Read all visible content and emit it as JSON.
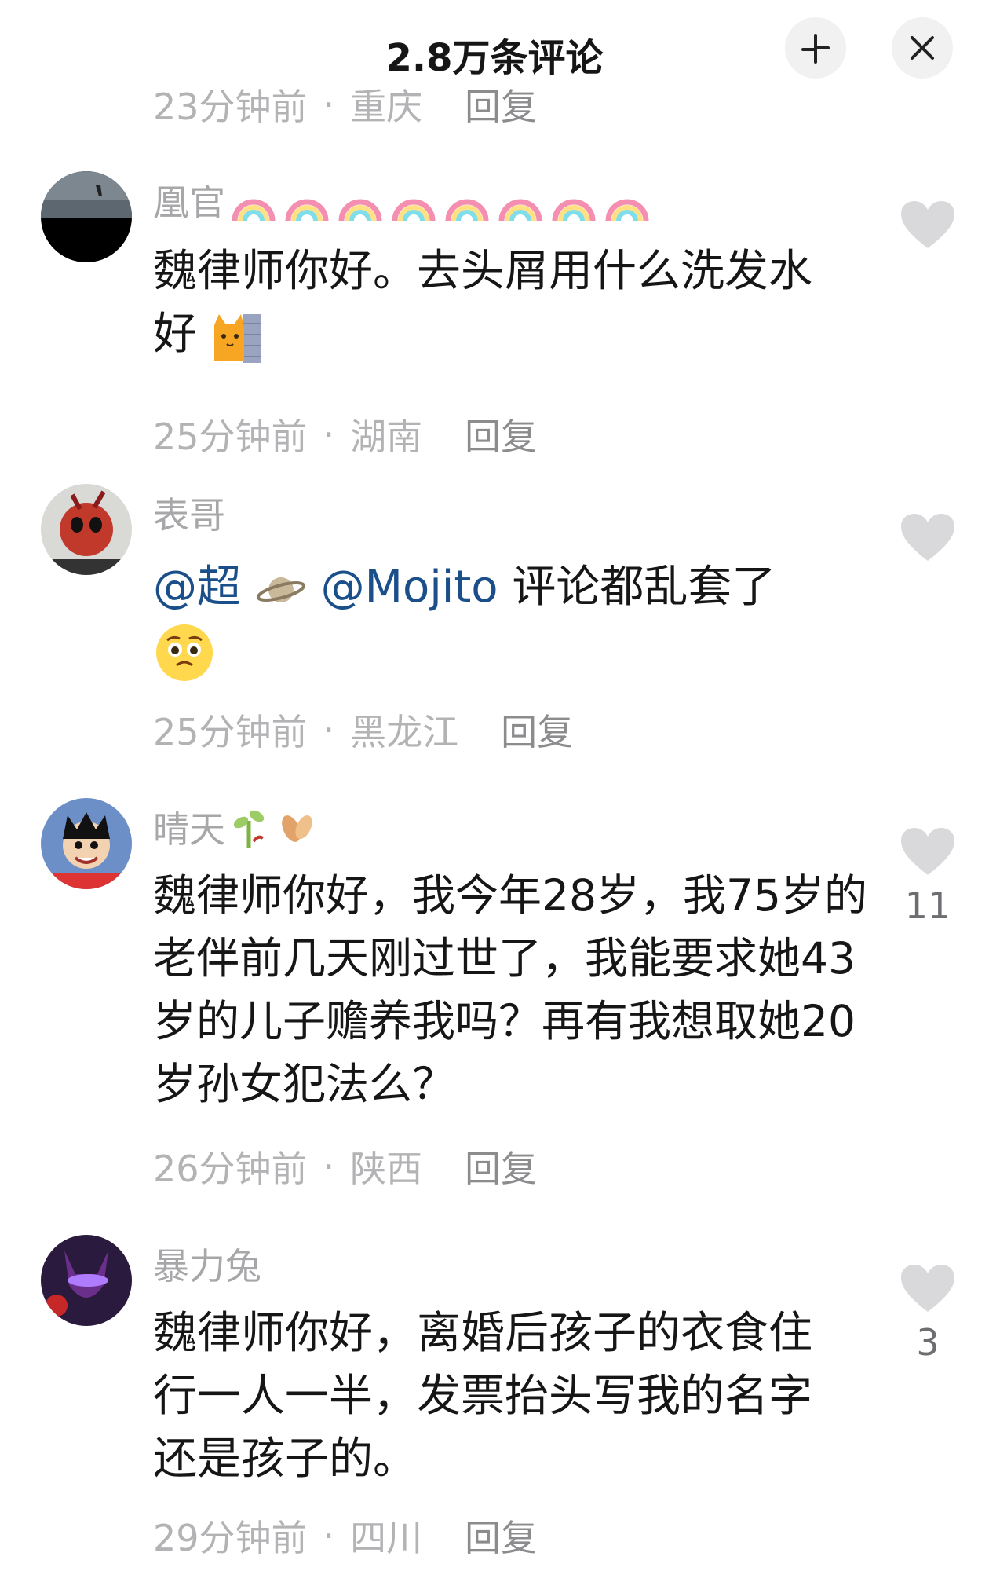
{
  "header": {
    "title": "2.8万条评论"
  },
  "top_meta": {
    "time": "23分钟前",
    "location": "重庆",
    "reply": "回复"
  },
  "comments": [
    {
      "username": "凰官",
      "username_deco": [
        "rainbow-emoji",
        "rainbow-emoji",
        "rainbow-emoji",
        "rainbow-emoji",
        "rainbow-emoji",
        "rainbow-emoji",
        "rainbow-emoji",
        "rainbow-emoji"
      ],
      "text": "魏律师你好。去头屑用什么洗发水好",
      "trailing_emoji": "cat-peeking-emoji",
      "time": "25分钟前",
      "location": "湖南",
      "reply": "回复",
      "likes": ""
    },
    {
      "username": "表哥",
      "mention_1": "@超",
      "mention_1_emoji": "planet-emoji",
      "mention_2": "@Mojito",
      "text": "评论都乱套了",
      "trailing_emoji": "pleading-face-emoji",
      "time": "25分钟前",
      "location": "黑龙江",
      "reply": "回复",
      "likes": ""
    },
    {
      "username": "晴天",
      "username_deco": [
        "sprout-emoji",
        "leaves-emoji"
      ],
      "text": "魏律师你好，我今年28岁，我75岁的老伴前几天刚过世了，我能要求她43岁的儿子赡养我吗？再有我想取她20岁孙女犯法么？",
      "time": "26分钟前",
      "location": "陕西",
      "reply": "回复",
      "likes": "11"
    },
    {
      "username": "暴力兔",
      "text": "魏律师你好，离婚后孩子的衣食住行一人一半，发票抬头写我的名字还是孩子的。",
      "time": "29分钟前",
      "location": "四川",
      "reply": "回复",
      "likes": "3"
    }
  ],
  "colors": {
    "meta": "#b3b3b6",
    "mention": "#1a4f8a",
    "like_icon": "#d9d9dc"
  }
}
